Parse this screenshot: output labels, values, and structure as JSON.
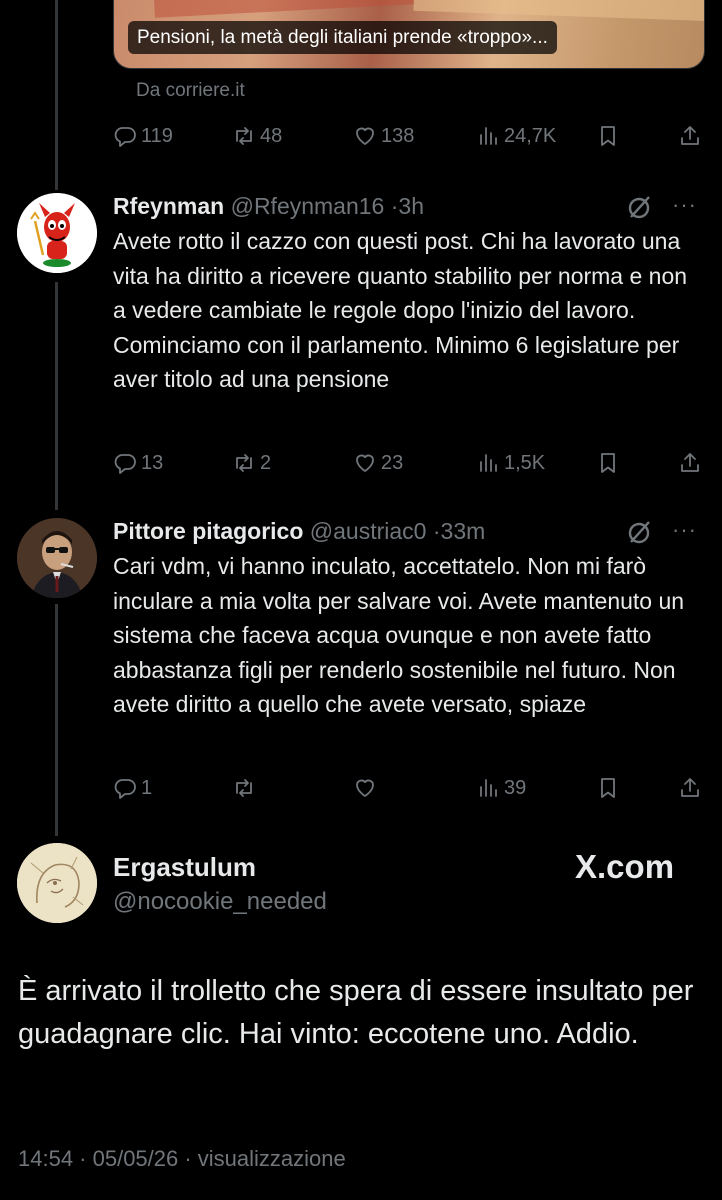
{
  "card": {
    "caption": "Pensioni, la metà degli italiani prende «troppo»...",
    "source": "Da corriere.it"
  },
  "top_actions": {
    "replies": "119",
    "reposts": "48",
    "likes": "138",
    "views": "24,7K"
  },
  "replies": [
    {
      "name": "Rfeynman",
      "handle": "@Rfeynman16",
      "time": "3h",
      "text": "Avete rotto il cazzo con questi post. Chi ha lavorato una vita ha diritto a ricevere quanto stabilito per norma e non a vedere cambiate le regole dopo l'inizio del lavoro. Cominciamo con il parlamento. Minimo 6 legislature per aver titolo ad una pensione",
      "actions": {
        "replies": "13",
        "reposts": "2",
        "likes": "23",
        "views": "1,5K"
      }
    },
    {
      "name": "Pittore pitagorico",
      "handle": "@austriac0",
      "time": "33m",
      "text": "Cari vdm, vi hanno inculato, accettatelo. Non mi farò inculare a mia volta per salvare voi. Avete mantenuto un sistema che faceva acqua ovunque e non avete fatto abbastanza figli per renderlo sostenibile nel futuro. Non avete diritto a quello che avete versato, spiaze",
      "actions": {
        "replies": "1",
        "reposts": "",
        "likes": "",
        "views": "39"
      }
    }
  ],
  "main_post": {
    "name": "Ergastulum",
    "handle": "@nocookie_needed",
    "watermark": "X.com",
    "text": "È arrivato il trolletto che spera di essere insultato per guadagnare clic. Hai vinto: eccotene uno. Addio.",
    "footer": "14:54 · 05/05/26 · visualizzazione"
  },
  "icons": {
    "reply": "reply-icon",
    "repost": "repost-icon",
    "like": "heart-icon",
    "views": "views-icon",
    "bookmark": "bookmark-icon",
    "share": "share-icon",
    "grok": "grok-icon",
    "more": "more-icon"
  },
  "colors": {
    "background": "#000000",
    "text": "#e7e9ea",
    "muted": "#71767b",
    "line": "#333639"
  }
}
